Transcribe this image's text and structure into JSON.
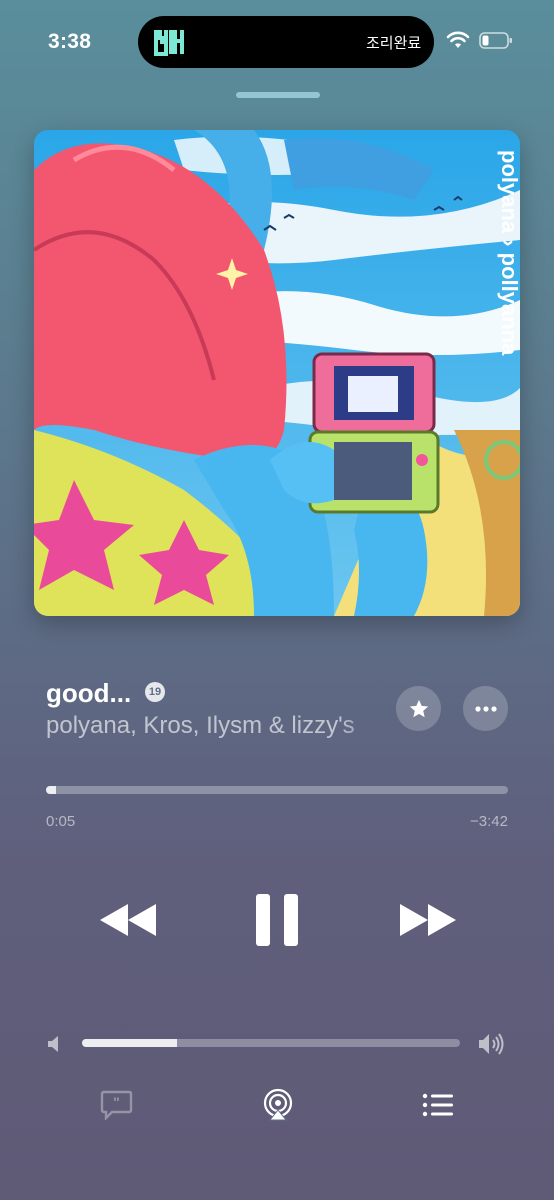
{
  "status_bar": {
    "time": "3:38",
    "island_text": "조리완료",
    "island_app_glyph": "비"
  },
  "track": {
    "title": "good...",
    "explicit_badge": "19",
    "artists": "polyana, Kros, Ilysm & lizzy's",
    "artwork_text": "polyana › pollyanna"
  },
  "progress": {
    "elapsed": "0:05",
    "remaining": "−3:42",
    "fraction": 0.022
  },
  "volume": {
    "fraction": 0.25
  },
  "icons": {
    "favorite": "star-icon",
    "more": "ellipsis-icon",
    "rewind": "backward-icon",
    "pause": "pause-icon",
    "forward": "forward-icon",
    "lyrics": "lyrics-icon",
    "airplay": "airplay-icon",
    "queue": "queue-icon"
  },
  "colors": {
    "accent": "#ffffff",
    "island_icon": "#7de8d6"
  }
}
